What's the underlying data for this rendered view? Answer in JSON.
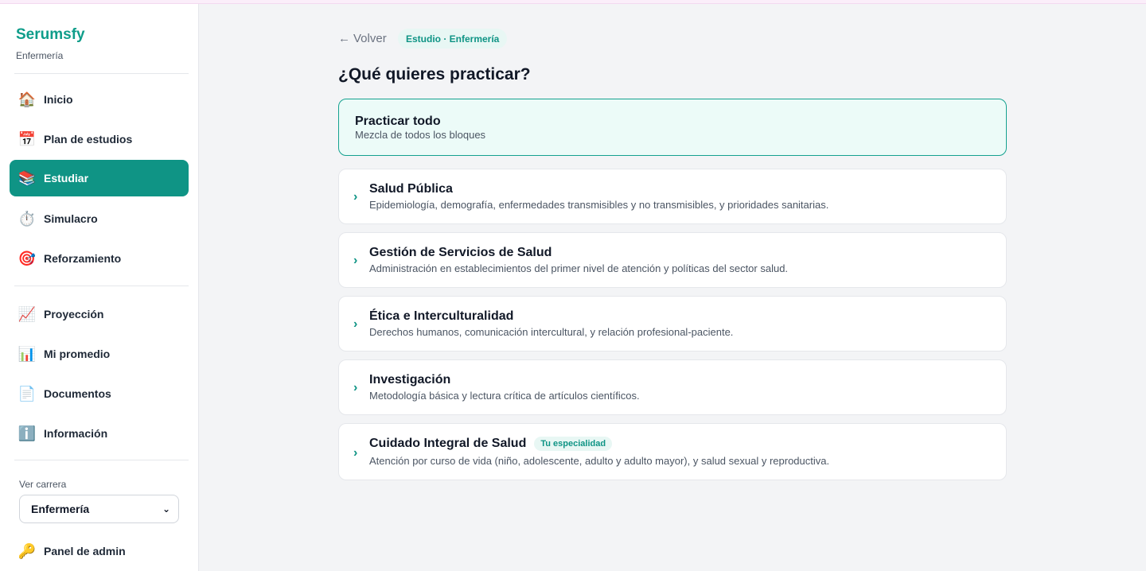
{
  "brand": {
    "name": "Serumsfy",
    "subtitle": "Enfermería"
  },
  "sidebar": {
    "nav_primary": [
      {
        "icon": "🏠",
        "label": "Inicio",
        "active": false
      },
      {
        "icon": "📅",
        "label": "Plan de estudios",
        "active": false
      },
      {
        "icon": "📚",
        "label": "Estudiar",
        "active": true
      },
      {
        "icon": "⏱️",
        "label": "Simulacro",
        "active": false
      },
      {
        "icon": "🎯",
        "label": "Reforzamiento",
        "active": false
      }
    ],
    "nav_secondary": [
      {
        "icon": "📈",
        "label": "Proyección"
      },
      {
        "icon": "📊",
        "label": "Mi promedio"
      },
      {
        "icon": "📄",
        "label": "Documentos"
      },
      {
        "icon": "ℹ️",
        "label": "Información"
      }
    ],
    "career_label": "Ver carrera",
    "career_selected": "Enfermería",
    "admin": {
      "icon": "🔑",
      "label": "Panel de admin"
    }
  },
  "main": {
    "back_label": "Volver",
    "breadcrumb": "Estudio · Enfermería",
    "title": "¿Qué quieres practicar?",
    "practice_all": {
      "title": "Practicar todo",
      "description": "Mezcla de todos los bloques"
    },
    "blocks": [
      {
        "title": "Salud Pública",
        "description": "Epidemiología, demografía, enfermedades transmisibles y no transmisibles, y prioridades sanitarias.",
        "badge": ""
      },
      {
        "title": "Gestión de Servicios de Salud",
        "description": "Administración en establecimientos del primer nivel de atención y políticas del sector salud.",
        "badge": ""
      },
      {
        "title": "Ética e Interculturalidad",
        "description": "Derechos humanos, comunicación intercultural, y relación profesional-paciente.",
        "badge": ""
      },
      {
        "title": "Investigación",
        "description": "Metodología básica y lectura crítica de artículos científicos.",
        "badge": ""
      },
      {
        "title": "Cuidado Integral de Salud",
        "description": "Atención por curso de vida (niño, adolescente, adulto y adulto mayor), y salud sexual y reproductiva.",
        "badge": "Tu especialidad"
      }
    ]
  },
  "colors": {
    "accent": "#0f9485",
    "brand": "#0f9d8a",
    "highlight_bg": "#ecfbf8"
  }
}
